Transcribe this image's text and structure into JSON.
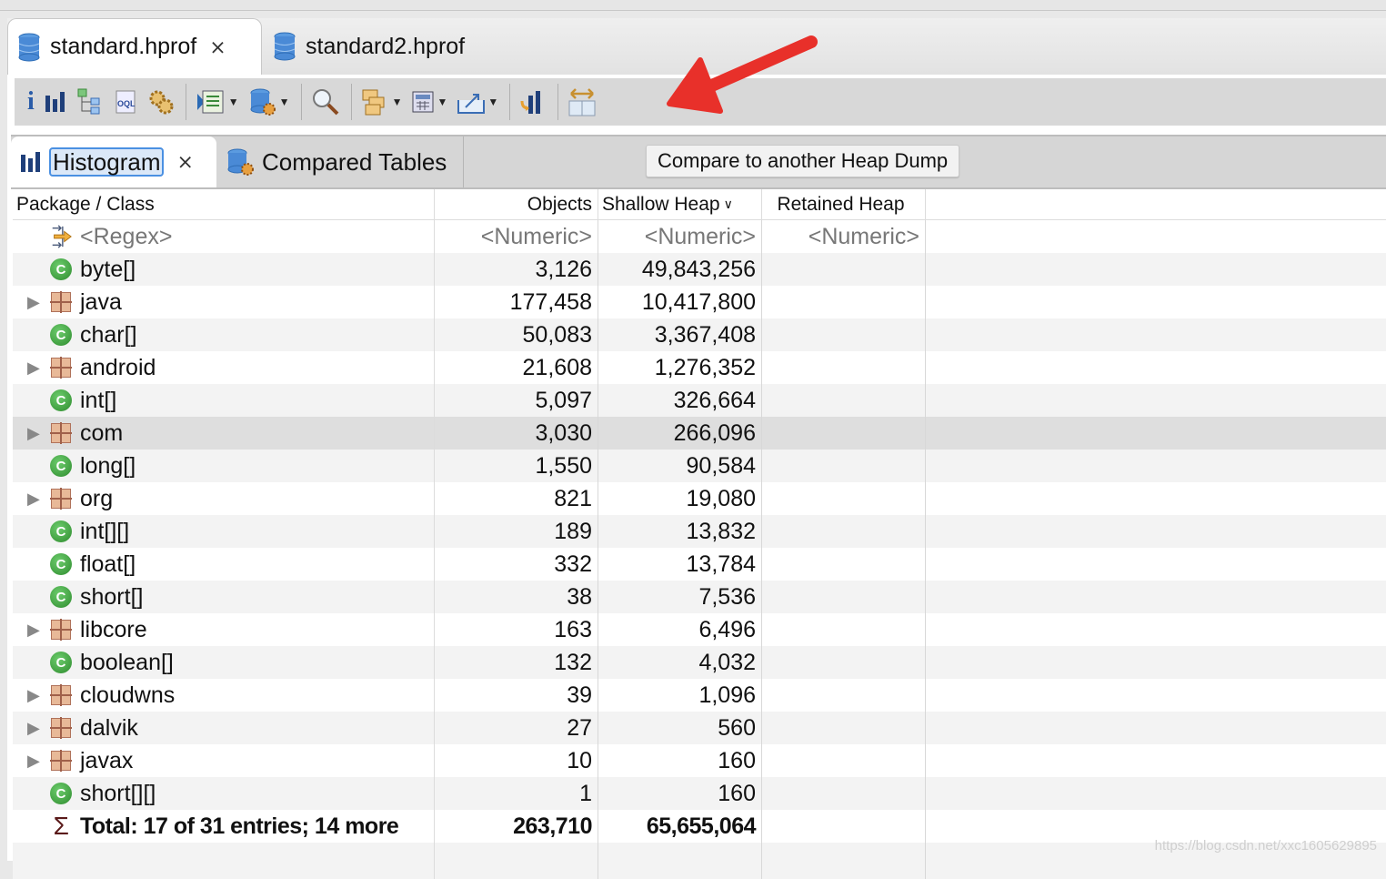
{
  "editor_tabs": [
    {
      "label": "standard.hprof",
      "active": true
    },
    {
      "label": "standard2.hprof",
      "active": false
    }
  ],
  "toolbar": {
    "items": [
      {
        "name": "info",
        "glyph": "i"
      },
      {
        "name": "histogram",
        "glyph": "▐"
      },
      {
        "name": "dominator-tree",
        "glyph": "☷"
      },
      {
        "name": "oql",
        "glyph": "OQL"
      },
      {
        "name": "heap-dump-overview",
        "glyph": "⚙"
      },
      {
        "name": "run-report",
        "glyph": "▶"
      },
      {
        "name": "query-browser",
        "glyph": "⛁"
      },
      {
        "name": "find-object",
        "glyph": "⚲"
      },
      {
        "name": "group-by",
        "glyph": "▣"
      },
      {
        "name": "calculate-retained",
        "glyph": "▦"
      },
      {
        "name": "export",
        "glyph": "⇗"
      },
      {
        "name": "compare-histogram",
        "glyph": "▐"
      },
      {
        "name": "compare-to-another-heap-dump",
        "glyph": "⇔"
      }
    ]
  },
  "view_tabs": [
    {
      "label": "Histogram",
      "active": true
    },
    {
      "label": "Compared Tables",
      "active": false
    }
  ],
  "tooltip": "Compare to another Heap Dump",
  "table": {
    "columns": [
      "Package / Class",
      "Objects",
      "Shallow Heap",
      "Retained Heap"
    ],
    "sort_indicator": "∨",
    "filter_row": [
      "<Regex>",
      "<Numeric>",
      "<Numeric>",
      "<Numeric>"
    ],
    "rows": [
      {
        "type": "class",
        "name": "byte[]",
        "objects": "3,126",
        "shallow": "49,843,256",
        "retained": ""
      },
      {
        "type": "package",
        "name": "java",
        "objects": "177,458",
        "shallow": "10,417,800",
        "retained": ""
      },
      {
        "type": "class",
        "name": "char[]",
        "objects": "50,083",
        "shallow": "3,367,408",
        "retained": ""
      },
      {
        "type": "package",
        "name": "android",
        "objects": "21,608",
        "shallow": "1,276,352",
        "retained": ""
      },
      {
        "type": "class",
        "name": "int[]",
        "objects": "5,097",
        "shallow": "326,664",
        "retained": ""
      },
      {
        "type": "package",
        "name": "com",
        "objects": "3,030",
        "shallow": "266,096",
        "retained": "",
        "selected": true
      },
      {
        "type": "class",
        "name": "long[]",
        "objects": "1,550",
        "shallow": "90,584",
        "retained": ""
      },
      {
        "type": "package",
        "name": "org",
        "objects": "821",
        "shallow": "19,080",
        "retained": ""
      },
      {
        "type": "class",
        "name": "int[][]",
        "objects": "189",
        "shallow": "13,832",
        "retained": ""
      },
      {
        "type": "class",
        "name": "float[]",
        "objects": "332",
        "shallow": "13,784",
        "retained": ""
      },
      {
        "type": "class",
        "name": "short[]",
        "objects": "38",
        "shallow": "7,536",
        "retained": ""
      },
      {
        "type": "package",
        "name": "libcore",
        "objects": "163",
        "shallow": "6,496",
        "retained": ""
      },
      {
        "type": "class",
        "name": "boolean[]",
        "objects": "132",
        "shallow": "4,032",
        "retained": ""
      },
      {
        "type": "package",
        "name": "cloudwns",
        "objects": "39",
        "shallow": "1,096",
        "retained": ""
      },
      {
        "type": "package",
        "name": "dalvik",
        "objects": "27",
        "shallow": "560",
        "retained": ""
      },
      {
        "type": "package",
        "name": "javax",
        "objects": "10",
        "shallow": "160",
        "retained": ""
      },
      {
        "type": "class",
        "name": "short[][]",
        "objects": "1",
        "shallow": "160",
        "retained": ""
      }
    ],
    "total": {
      "label": "Total: 17 of 31 entries; 14 more",
      "objects": "263,710",
      "shallow": "65,655,064",
      "retained": ""
    }
  },
  "watermark": "https://blog.csdn.net/xxc1605629895",
  "colors": {
    "annotation_arrow": "#e8302a",
    "selection": "#4a90e2"
  }
}
